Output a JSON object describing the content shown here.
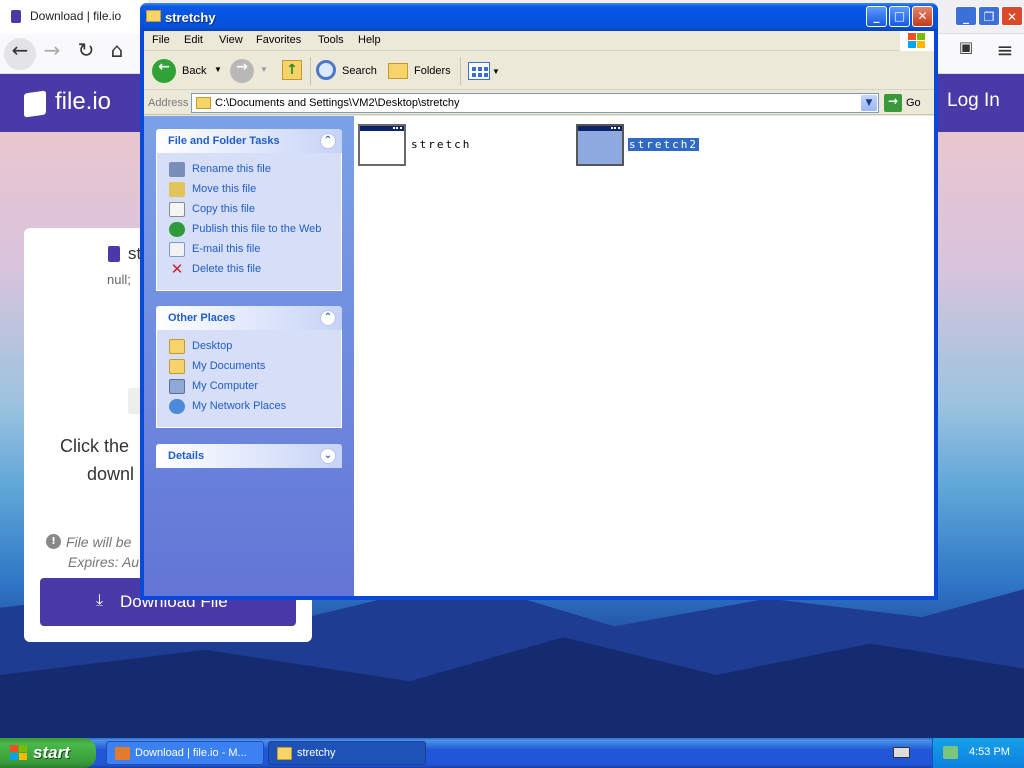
{
  "browser": {
    "tab_title": "Download | file.io",
    "site": {
      "logo_text": "file.io",
      "login_label": "Log In",
      "file_name_partial": "st",
      "file_meta_partial": "null; ",
      "click_text_line1": "Click the",
      "click_text_line2": "downl",
      "info_line1": "File will be",
      "info_line2": "Expires: Au",
      "download_button": "Download File"
    },
    "brand_color": "#4a3aa8"
  },
  "explorer": {
    "title": "stretchy",
    "menu": [
      "File",
      "Edit",
      "View",
      "Favorites",
      "Tools",
      "Help"
    ],
    "toolbar": {
      "back_label": "Back",
      "search_label": "Search",
      "folders_label": "Folders"
    },
    "address_label": "Address",
    "address_path": "C:\\Documents and Settings\\VM2\\Desktop\\stretchy",
    "go_label": "Go",
    "task_panels": {
      "file_tasks": {
        "title": "File and Folder Tasks",
        "items": [
          {
            "label": "Rename this file",
            "icon": "rename-icon"
          },
          {
            "label": "Move this file",
            "icon": "move-icon"
          },
          {
            "label": "Copy this file",
            "icon": "copy-icon"
          },
          {
            "label": "Publish this file to the Web",
            "icon": "publish-icon"
          },
          {
            "label": "E-mail this file",
            "icon": "email-icon"
          },
          {
            "label": "Delete this file",
            "icon": "delete-icon"
          }
        ]
      },
      "other_places": {
        "title": "Other Places",
        "items": [
          {
            "label": "Desktop",
            "icon": "folder-icon"
          },
          {
            "label": "My Documents",
            "icon": "my-documents-icon"
          },
          {
            "label": "My Computer",
            "icon": "my-computer-icon"
          },
          {
            "label": "My Network Places",
            "icon": "network-icon"
          }
        ]
      },
      "details": {
        "title": "Details"
      }
    },
    "files": [
      {
        "name": "stretch",
        "selected": false
      },
      {
        "name": "stretch2",
        "selected": true
      }
    ]
  },
  "taskbar": {
    "start_label": "start",
    "tasks": [
      {
        "label": "Download | file.io - M...",
        "active": false
      },
      {
        "label": "stretchy",
        "active": true
      }
    ],
    "clock": "4:53 PM"
  }
}
